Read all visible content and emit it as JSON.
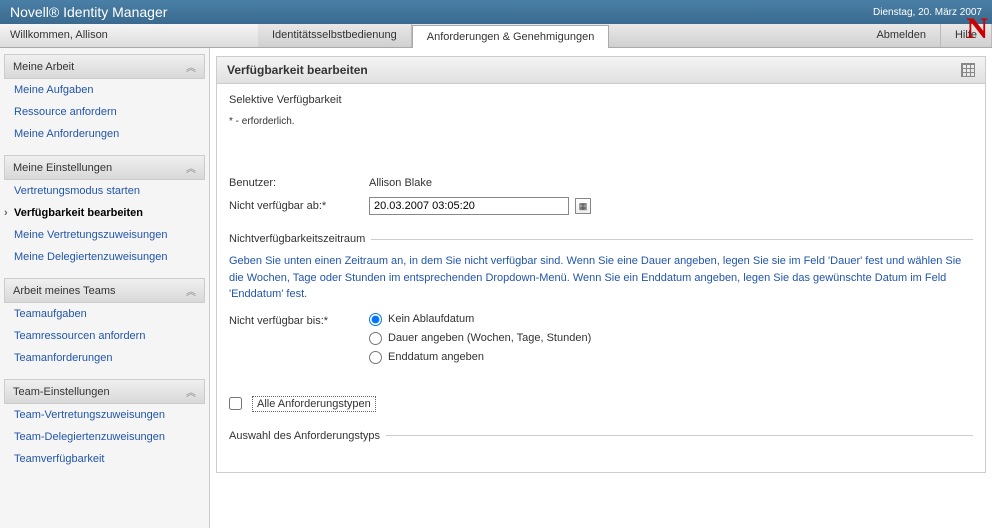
{
  "header": {
    "title": "Novell® Identity Manager",
    "date": "Dienstag, 20. März 2007"
  },
  "subheader": {
    "welcome": "Willkommen, Allison",
    "tabs": {
      "identity": "Identitätsselbstbedienung",
      "requests": "Anforderungen & Genehmigungen",
      "logout": "Abmelden",
      "help": "Hilfe"
    }
  },
  "sidebar": {
    "sections": [
      {
        "title": "Meine Arbeit",
        "items": [
          "Meine Aufgaben",
          "Ressource anfordern",
          "Meine Anforderungen"
        ]
      },
      {
        "title": "Meine Einstellungen",
        "items": [
          "Vertretungsmodus starten",
          "Verfügbarkeit bearbeiten",
          "Meine Vertretungszuweisungen",
          "Meine Delegiertenzuweisungen"
        ],
        "selected": 1
      },
      {
        "title": "Arbeit meines Teams",
        "items": [
          "Teamaufgaben",
          "Teamressourcen anfordern",
          "Teamanforderungen"
        ]
      },
      {
        "title": "Team-Einstellungen",
        "items": [
          "Team-Vertretungszuweisungen",
          "Team-Delegiertenzuweisungen",
          "Teamverfügbarkeit"
        ]
      }
    ]
  },
  "panel": {
    "title": "Verfügbarkeit bearbeiten",
    "subtitle": "Selektive Verfügbarkeit",
    "required_note": "* - erforderlich.",
    "user_label": "Benutzer:",
    "user_value": "Allison Blake",
    "unavailable_from_label": "Nicht verfügbar ab:*",
    "unavailable_from_value": "20.03.2007 03:05:20",
    "duration_fieldset": {
      "legend": "Nichtverfügbarkeitszeitraum",
      "description": "Geben Sie unten einen Zeitraum an, in dem Sie nicht verfügbar sind. Wenn Sie eine Dauer angeben, legen Sie sie im Feld 'Dauer' fest und wählen Sie die Wochen, Tage oder Stunden im entsprechenden Dropdown-Menü. Wenn Sie ein Enddatum angeben, legen Sie das gewünschte Datum im Feld 'Enddatum' fest.",
      "until_label": "Nicht verfügbar bis:*",
      "options": {
        "no_expiry": "Kein Ablaufdatum",
        "duration": "Dauer angeben (Wochen, Tage, Stunden)",
        "end_date": "Enddatum angeben"
      }
    },
    "all_types_label": "Alle Anforderungstypen",
    "selection_fieldset": {
      "legend": "Auswahl des Anforderungstyps"
    }
  }
}
